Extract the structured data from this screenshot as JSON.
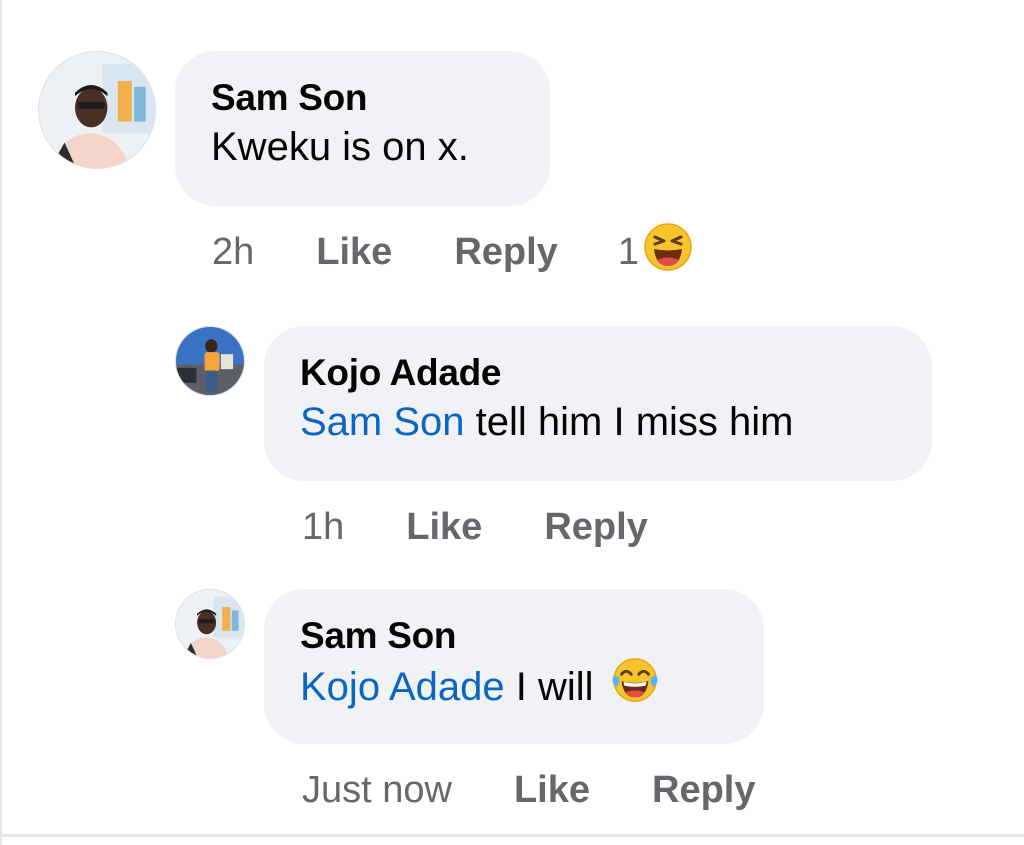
{
  "comments": [
    {
      "author": "Sam Son",
      "text": "Kweku is on x.",
      "time": "2h",
      "like_label": "Like",
      "reply_label": "Reply",
      "reaction_count": "1",
      "reaction_icon": "laughing-squint-emoji"
    },
    {
      "author": "Kojo Adade",
      "mention": "Sam Son",
      "text": "tell him I miss him",
      "time": "1h",
      "like_label": "Like",
      "reply_label": "Reply"
    },
    {
      "author": "Sam Son",
      "mention": "Kojo Adade",
      "text": "I will",
      "text_emoji": "tears-of-joy-emoji",
      "time": "Just now",
      "like_label": "Like",
      "reply_label": "Reply"
    }
  ],
  "colors": {
    "bubble_bg": "#f0f2f5",
    "mention": "#0a66c2",
    "meta_text": "#65676b",
    "text": "#050505"
  }
}
